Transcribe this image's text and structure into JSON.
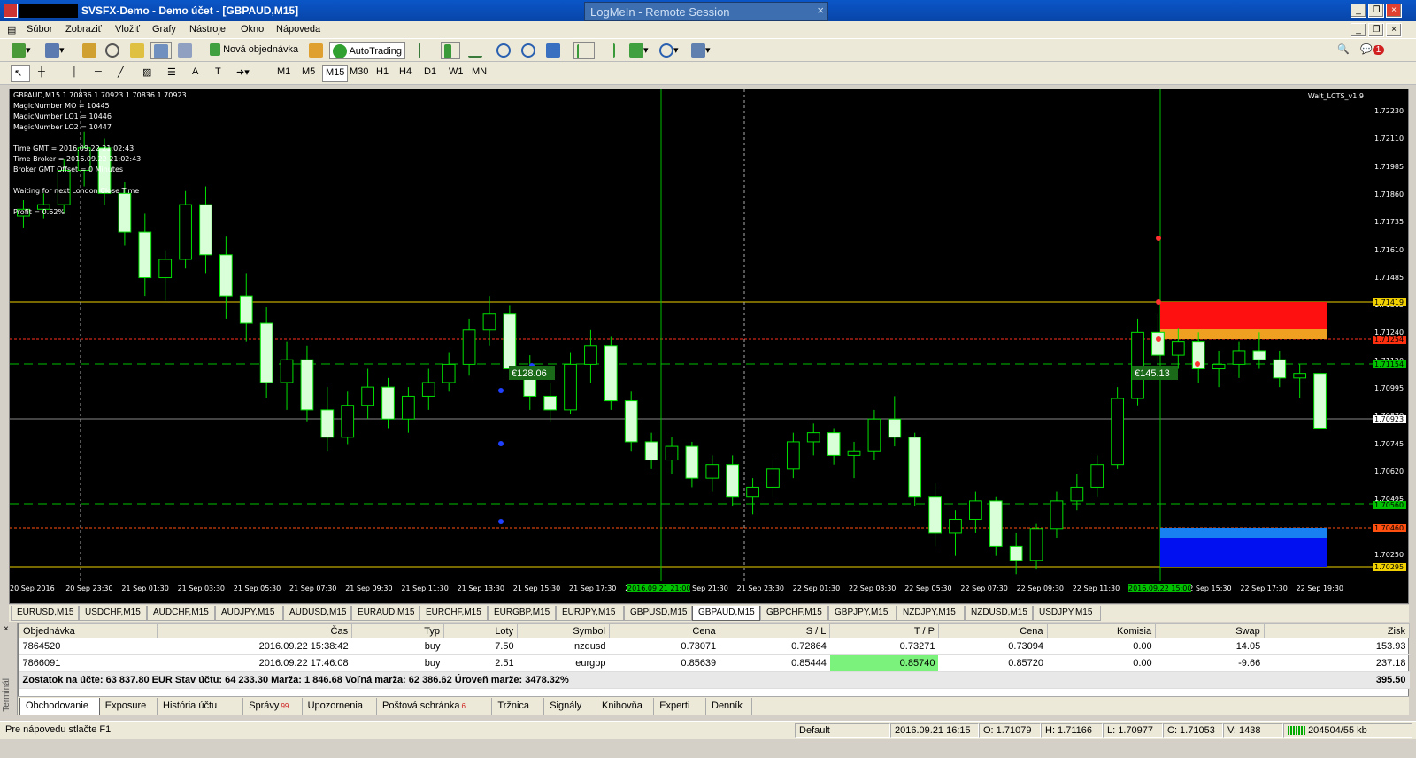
{
  "window": {
    "title": "SVSFX-Demo - Demo účet - [GBPAUD,M15]",
    "remote": "LogMeIn - Remote Session"
  },
  "menu": [
    "Súbor",
    "Zobraziť",
    "Vložiť",
    "Grafy",
    "Nástroje",
    "Okno",
    "Nápoveda"
  ],
  "toolbar": {
    "new_order": "Nová objednávka",
    "autotrading": "AutoTrading",
    "notifications": "1"
  },
  "timeframes": [
    "M1",
    "M5",
    "M15",
    "M30",
    "H1",
    "H4",
    "D1",
    "W1",
    "MN"
  ],
  "chart": {
    "header": "GBPAUD,M15  1.70836 1.70923 1.70836 1.70923",
    "indicator": "Walt_LCTS_v1.9",
    "info": [
      "MagicNumber MO = 10445",
      "MagicNumber LO1 = 10446",
      "MagicNumber LO2 = 10447",
      "",
      "Time   GMT = 2016.09.22 21:02:43",
      "Time Broker = 2016.09.22 21:02:43",
      "Broker GMT Offset = 0 Minutes",
      "",
      "Waiting for next London Close Time",
      "",
      "Profit = 0.62%"
    ],
    "price_ticks": [
      "1.72230",
      "1.72110",
      "1.71985",
      "1.71860",
      "1.71735",
      "1.71610",
      "1.71485",
      "1.71365",
      "1.71240",
      "1.71120",
      "1.70995",
      "1.70870",
      "1.70745",
      "1.70620",
      "1.70495",
      "1.70370",
      "1.70250"
    ],
    "price_labels": [
      {
        "text": "1.71419",
        "bg": "#f0d000",
        "fg": "#000"
      },
      {
        "text": "1.71254",
        "bg": "#ff3010",
        "fg": "#000"
      },
      {
        "text": "1.71154",
        "bg": "#00c000",
        "fg": "#000"
      },
      {
        "text": "1.70923",
        "bg": "#ffffff",
        "fg": "#000"
      },
      {
        "text": "1.70560",
        "bg": "#00c000",
        "fg": "#000"
      },
      {
        "text": "1.70460",
        "bg": "#ff5010",
        "fg": "#000"
      },
      {
        "text": "1.70295",
        "bg": "#f0d000",
        "fg": "#000"
      }
    ],
    "time_ticks": [
      "20 Sep 2016",
      "20 Sep 23:30",
      "21 Sep 01:30",
      "21 Sep 03:30",
      "21 Sep 05:30",
      "21 Sep 07:30",
      "21 Sep 09:30",
      "21 Sep 11:30",
      "21 Sep 13:30",
      "21 Sep 15:30",
      "21 Sep 17:30",
      "21 Sep 19:30",
      "21 Sep 21:30",
      "21 Sep 23:30",
      "22 Sep 01:30",
      "22 Sep 03:30",
      "22 Sep 05:30",
      "22 Sep 07:30",
      "22 Sep 09:30",
      "22 Sep 11:30",
      "22 Sep 13:30",
      "22 Sep 15:30",
      "22 Sep 17:30",
      "22 Sep 19:30"
    ],
    "time_highlights": [
      "2016.09.21 21:00",
      "2016.09.22 15:00"
    ],
    "profit_labels": [
      "€128.06",
      "€145.13"
    ]
  },
  "symbol_tabs": [
    "EURUSD,M15",
    "USDCHF,M15",
    "AUDCHF,M15",
    "AUDJPY,M15",
    "AUDUSD,M15",
    "EURAUD,M15",
    "EURCHF,M15",
    "EURGBP,M15",
    "EURJPY,M15",
    "GBPUSD,M15",
    "GBPAUD,M15",
    "GBPCHF,M15",
    "GBPJPY,M15",
    "NZDJPY,M15",
    "NZDUSD,M15",
    "USDJPY,M15"
  ],
  "active_symbol_tab": "GBPAUD,M15",
  "orders": {
    "columns": [
      "Objednávka",
      "Čas",
      "Typ",
      "Loty",
      "Symbol",
      "Cena",
      "S / L",
      "T / P",
      "Cena",
      "Komisia",
      "Swap",
      "Zisk"
    ],
    "rows": [
      [
        "7864520",
        "2016.09.22 15:38:42",
        "buy",
        "7.50",
        "nzdusd",
        "0.73071",
        "0.72864",
        "0.73271",
        "0.73094",
        "0.00",
        "14.05",
        "153.93"
      ],
      [
        "7866091",
        "2016.09.22 17:46:08",
        "buy",
        "2.51",
        "eurgbp",
        "0.85639",
        "0.85444",
        "0.85740",
        "0.85720",
        "0.00",
        "-9.66",
        "237.18"
      ]
    ],
    "summary": "Zostatok na účte: 63 837.80 EUR  Stav účtu: 64 233.30  Marža: 1 846.68  Voľná marža: 62 386.62  Úroveň marže: 3478.32%",
    "summary_total": "395.50"
  },
  "terminal_label": "Terminál",
  "bottom_tabs": [
    "Obchodovanie",
    "Exposure",
    "História účtu",
    "Správy",
    "Upozornenia",
    "Poštová schránka",
    "Tržnica",
    "Signály",
    "Knihovňa",
    "Experti",
    "Denník"
  ],
  "bottom_badges": {
    "Správy": "99",
    "Poštová schránka": "6"
  },
  "status": {
    "help": "Pre nápovedu stlačte F1",
    "profile": "Default",
    "time": "2016.09.21 16:15",
    "open": "O: 1.71079",
    "high": "H: 1.71166",
    "low": "L: 1.70977",
    "close": "C: 1.71053",
    "volume": "V: 1438",
    "traffic": "204504/55 kb"
  },
  "candles": [
    [
      1.7185,
      1.7192,
      1.718,
      1.7188
    ],
    [
      1.7188,
      1.7195,
      1.7184,
      1.719
    ],
    [
      1.719,
      1.721,
      1.7186,
      1.7205
    ],
    [
      1.7205,
      1.7222,
      1.7198,
      1.7215
    ],
    [
      1.7215,
      1.7219,
      1.719,
      1.7195
    ],
    [
      1.7195,
      1.72,
      1.7172,
      1.7178
    ],
    [
      1.7178,
      1.7186,
      1.715,
      1.7158
    ],
    [
      1.7158,
      1.717,
      1.7148,
      1.7166
    ],
    [
      1.7166,
      1.7196,
      1.7162,
      1.719
    ],
    [
      1.719,
      1.7198,
      1.716,
      1.7168
    ],
    [
      1.7168,
      1.7176,
      1.714,
      1.715
    ],
    [
      1.715,
      1.716,
      1.713,
      1.7138
    ],
    [
      1.7138,
      1.7145,
      1.7105,
      1.7112
    ],
    [
      1.7112,
      1.713,
      1.71,
      1.7122
    ],
    [
      1.7122,
      1.7128,
      1.7095,
      1.71
    ],
    [
      1.71,
      1.711,
      1.7082,
      1.7088
    ],
    [
      1.7088,
      1.7108,
      1.7085,
      1.7102
    ],
    [
      1.7102,
      1.7118,
      1.7096,
      1.711
    ],
    [
      1.711,
      1.7114,
      1.7092,
      1.7096
    ],
    [
      1.7096,
      1.711,
      1.709,
      1.7106
    ],
    [
      1.7106,
      1.7118,
      1.71,
      1.7112
    ],
    [
      1.7112,
      1.7125,
      1.7108,
      1.712
    ],
    [
      1.712,
      1.714,
      1.7115,
      1.7135
    ],
    [
      1.7135,
      1.715,
      1.7128,
      1.7142
    ],
    [
      1.7142,
      1.7146,
      1.7115,
      1.7118
    ],
    [
      1.7118,
      1.7124,
      1.71,
      1.7106
    ],
    [
      1.7106,
      1.7112,
      1.7095,
      1.71
    ],
    [
      1.71,
      1.7125,
      1.7098,
      1.712
    ],
    [
      1.712,
      1.7135,
      1.7112,
      1.7128
    ],
    [
      1.7128,
      1.7132,
      1.71,
      1.7104
    ],
    [
      1.7104,
      1.7108,
      1.7082,
      1.7086
    ],
    [
      1.7086,
      1.709,
      1.7074,
      1.7078
    ],
    [
      1.7078,
      1.7088,
      1.7072,
      1.7084
    ],
    [
      1.7084,
      1.7086,
      1.7066,
      1.707
    ],
    [
      1.707,
      1.708,
      1.7064,
      1.7076
    ],
    [
      1.7076,
      1.708,
      1.7058,
      1.7062
    ],
    [
      1.7062,
      1.707,
      1.7054,
      1.7066
    ],
    [
      1.7066,
      1.7078,
      1.7062,
      1.7074
    ],
    [
      1.7074,
      1.709,
      1.707,
      1.7086
    ],
    [
      1.7086,
      1.7094,
      1.708,
      1.709
    ],
    [
      1.709,
      1.7092,
      1.7076,
      1.708
    ],
    [
      1.708,
      1.7086,
      1.707,
      1.7082
    ],
    [
      1.7082,
      1.71,
      1.7078,
      1.7096
    ],
    [
      1.7096,
      1.7106,
      1.7084,
      1.7088
    ],
    [
      1.7088,
      1.709,
      1.7058,
      1.7062
    ],
    [
      1.7062,
      1.7068,
      1.704,
      1.7046
    ],
    [
      1.7046,
      1.7056,
      1.7036,
      1.7052
    ],
    [
      1.7052,
      1.7064,
      1.7046,
      1.706
    ],
    [
      1.706,
      1.7062,
      1.7036,
      1.704
    ],
    [
      1.704,
      1.7046,
      1.7028,
      1.7034
    ],
    [
      1.7034,
      1.705,
      1.703,
      1.7048
    ],
    [
      1.7048,
      1.7064,
      1.7044,
      1.706
    ],
    [
      1.706,
      1.7072,
      1.7056,
      1.7066
    ],
    [
      1.7066,
      1.708,
      1.7062,
      1.7076
    ],
    [
      1.7076,
      1.711,
      1.7074,
      1.7105
    ],
    [
      1.7105,
      1.714,
      1.7102,
      1.7134
    ],
    [
      1.7134,
      1.7142,
      1.7118,
      1.7124
    ],
    [
      1.7124,
      1.7136,
      1.7118,
      1.713
    ],
    [
      1.713,
      1.7134,
      1.7112,
      1.7118
    ],
    [
      1.7118,
      1.7126,
      1.711,
      1.712
    ],
    [
      1.712,
      1.713,
      1.7114,
      1.7126
    ],
    [
      1.7126,
      1.7134,
      1.7118,
      1.7122
    ],
    [
      1.7122,
      1.7126,
      1.711,
      1.7114
    ],
    [
      1.7114,
      1.712,
      1.7105,
      1.7116
    ],
    [
      1.7116,
      1.7118,
      1.7098,
      1.7092
    ]
  ]
}
